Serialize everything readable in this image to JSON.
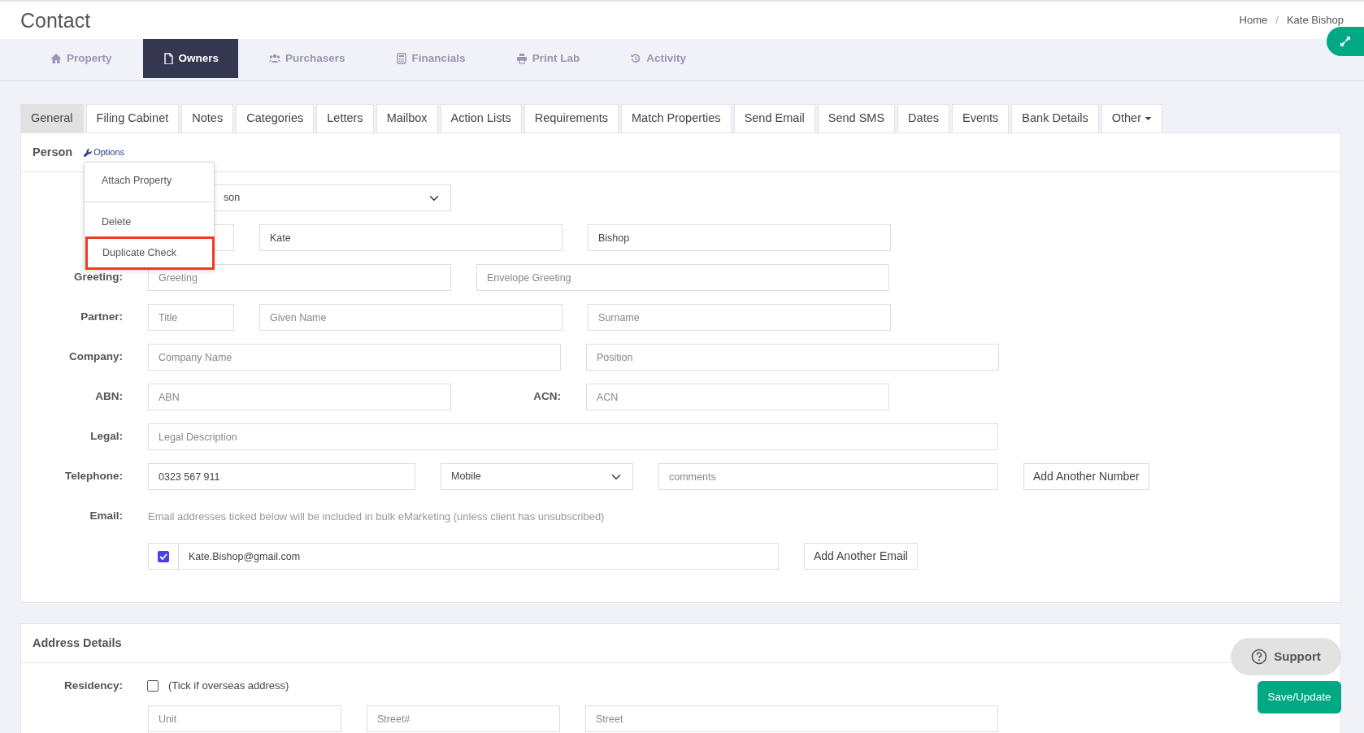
{
  "page": {
    "title": "Contact",
    "breadcrumb": {
      "items": [
        "Home",
        "Kate Bishop"
      ],
      "separator": "/"
    }
  },
  "module_tabs": [
    {
      "label": "Property",
      "selected": false
    },
    {
      "label": "Owners",
      "selected": true
    },
    {
      "label": "Purchasers",
      "selected": false
    },
    {
      "label": "Financials",
      "selected": false
    },
    {
      "label": "Print Lab",
      "selected": false
    },
    {
      "label": "Activity",
      "selected": false
    }
  ],
  "sub_tabs": [
    {
      "label": "General",
      "selected": true
    },
    {
      "label": "Filing Cabinet",
      "selected": false
    },
    {
      "label": "Notes",
      "selected": false
    },
    {
      "label": "Categories",
      "selected": false
    },
    {
      "label": "Letters",
      "selected": false
    },
    {
      "label": "Mailbox",
      "selected": false
    },
    {
      "label": "Action Lists",
      "selected": false
    },
    {
      "label": "Requirements",
      "selected": false
    },
    {
      "label": "Match Properties",
      "selected": false
    },
    {
      "label": "Send Email",
      "selected": false
    },
    {
      "label": "Send SMS",
      "selected": false
    },
    {
      "label": "Dates",
      "selected": false
    },
    {
      "label": "Events",
      "selected": false
    },
    {
      "label": "Bank Details",
      "selected": false
    },
    {
      "label": "Other",
      "selected": false,
      "kind": "dropdown"
    }
  ],
  "person_panel": {
    "title": "Person",
    "options_link": "Options",
    "options_menu": [
      {
        "label": "Attach Property",
        "highlighted": false
      },
      {
        "label": "Delete",
        "highlighted": false
      },
      {
        "label": "Duplicate Check",
        "highlighted": true
      }
    ],
    "rows": [
      {
        "fields": [
          {
            "kind": "select",
            "value": "son"
          }
        ]
      },
      {
        "fields": [
          {
            "kind": "input"
          },
          {
            "kind": "input",
            "value": "Kate"
          },
          {
            "kind": "input",
            "value": "Bishop"
          }
        ]
      },
      {
        "label": "Greeting:",
        "fields": [
          {
            "kind": "input",
            "placeholder": "Greeting"
          },
          {
            "kind": "input",
            "placeholder": "Envelope Greeting"
          }
        ]
      },
      {
        "label": "Partner:",
        "fields": [
          {
            "kind": "input",
            "placeholder": "Title"
          },
          {
            "kind": "input",
            "placeholder": "Given Name"
          },
          {
            "kind": "input",
            "placeholder": "Surname"
          }
        ]
      },
      {
        "label": "Company:",
        "fields": [
          {
            "kind": "input",
            "placeholder": "Company Name"
          },
          {
            "kind": "input",
            "placeholder": "Position"
          }
        ]
      },
      {
        "label": "ABN:",
        "fields": [
          {
            "kind": "input",
            "placeholder": "ABN"
          },
          {
            "kind": "label",
            "text": "ACN:"
          },
          {
            "kind": "input",
            "placeholder": "ACN"
          }
        ]
      },
      {
        "label": "Legal:",
        "fields": [
          {
            "kind": "input",
            "placeholder": "Legal Description"
          }
        ]
      },
      {
        "label": "Telephone:",
        "fields": [
          {
            "kind": "input",
            "value": "0323 567 911"
          },
          {
            "kind": "select",
            "value": "Mobile"
          },
          {
            "kind": "input",
            "placeholder": "comments"
          },
          {
            "kind": "button",
            "text": "Add Another Number"
          }
        ]
      },
      {
        "label": "Email:",
        "fields": [
          {
            "kind": "help",
            "text": "Email addresses ticked below will be included in bulk eMarketing (unless client has unsubscribed)"
          }
        ]
      },
      {
        "fields": [
          {
            "kind": "email",
            "checked": true,
            "value": "Kate.Bishop@gmail.com"
          },
          {
            "kind": "button",
            "text": "Add Another Email"
          }
        ]
      }
    ]
  },
  "address_panel": {
    "title": "Address Details",
    "residency_label": "Residency:",
    "overseas_checked": false,
    "overseas_text": "(Tick if overseas address)",
    "fields": [
      {
        "placeholder": "Unit"
      },
      {
        "placeholder": "Street#"
      },
      {
        "placeholder": "Street"
      }
    ]
  },
  "support_button": "Support",
  "save_button": "Save/Update"
}
